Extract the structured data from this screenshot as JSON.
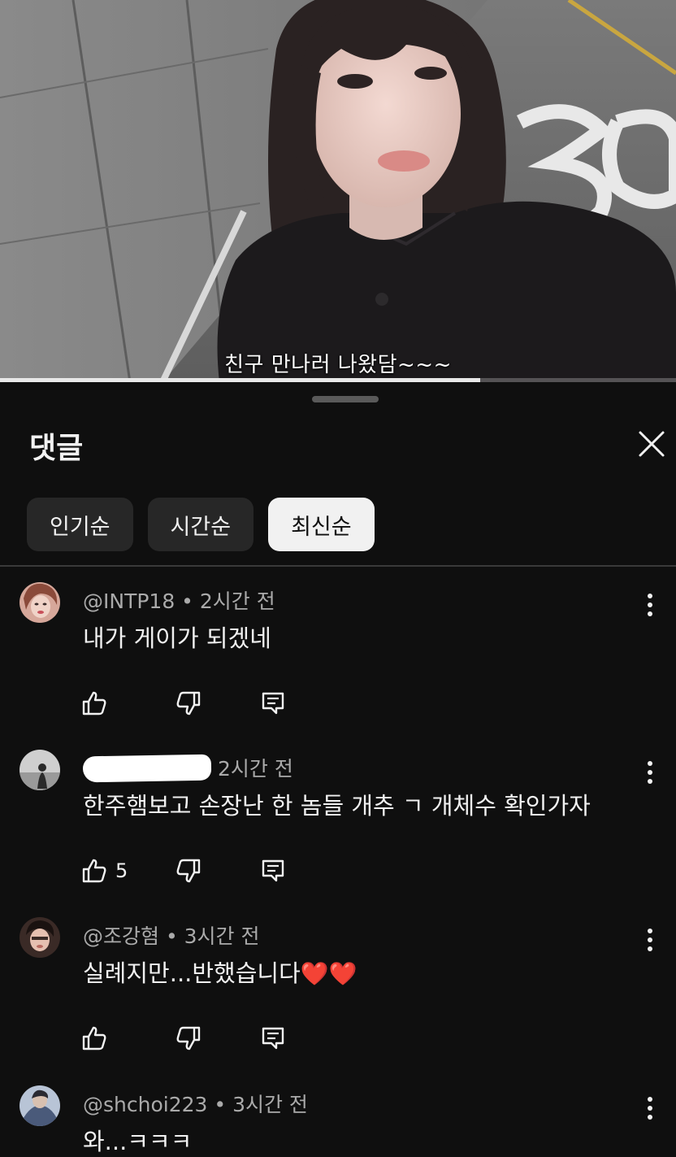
{
  "video": {
    "caption": "친구 만나러 나왔담~~~",
    "progress": 0.71
  },
  "comments_panel": {
    "title": "댓글",
    "sort_chips": [
      {
        "label": "인기순",
        "active": false
      },
      {
        "label": "시간순",
        "active": false
      },
      {
        "label": "최신순",
        "active": true
      }
    ]
  },
  "comments": [
    {
      "author": "@INTP18",
      "separator": " • ",
      "time": "2시간 전",
      "text": "내가 게이가 되겠네",
      "likes": ""
    },
    {
      "author": "",
      "separator": "",
      "time": "2시간 전",
      "text": "한주햄보고 손장난 한 놈들 개추 ㄱ 개체수 확인가자",
      "likes": "5"
    },
    {
      "author": "@조강혐",
      "separator": " • ",
      "time": "3시간 전",
      "text": "실례지만...반했습니다",
      "emoji": "❤️❤️",
      "likes": ""
    },
    {
      "author": "@shchoi223",
      "separator": " • ",
      "time": "3시간 전",
      "text": "와...ㅋㅋㅋ",
      "likes": ""
    }
  ],
  "icons": {
    "like": "thumb-up-icon",
    "dislike": "thumb-down-icon",
    "reply": "reply-icon",
    "more": "more-vertical-icon",
    "close": "close-icon"
  },
  "colors": {
    "background": "#0f0f0f",
    "chip": "#272727",
    "chip_active": "#f1f1f1",
    "meta_text": "#aaaaaa",
    "primary_text": "#f1f1f1"
  }
}
